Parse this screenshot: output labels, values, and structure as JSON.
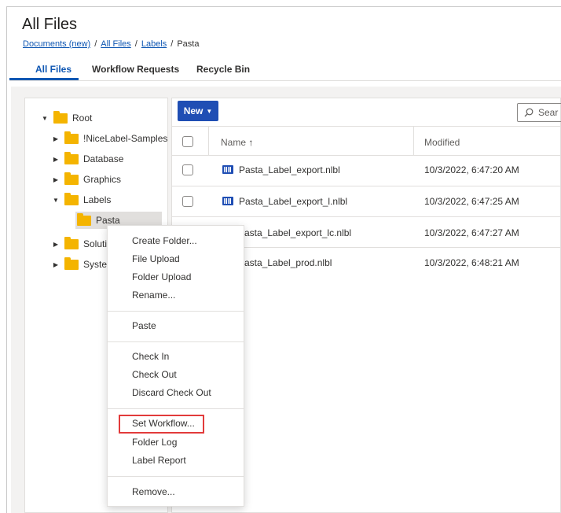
{
  "page": {
    "title": "All Files"
  },
  "breadcrumb": {
    "items": [
      "Documents (new)",
      "All Files",
      "Labels"
    ],
    "current": "Pasta",
    "separator": "/"
  },
  "tabs": [
    {
      "label": "All Files",
      "active": true
    },
    {
      "label": "Workflow Requests",
      "active": false
    },
    {
      "label": "Recycle Bin",
      "active": false
    }
  ],
  "tree": {
    "items": [
      {
        "label": "Root",
        "expanded": true
      },
      {
        "label": "!NiceLabel-Samples",
        "expanded": false
      },
      {
        "label": "Database",
        "expanded": false
      },
      {
        "label": "Graphics",
        "expanded": false
      },
      {
        "label": "Labels",
        "expanded": true
      },
      {
        "label": "Pasta",
        "selected": true
      },
      {
        "label": "Solutio",
        "expanded": false
      },
      {
        "label": "Syster",
        "expanded": false
      }
    ]
  },
  "toolbar": {
    "new_label": "New",
    "search_placeholder": "Sear"
  },
  "table": {
    "headers": {
      "name": "Name",
      "name_sort": "↑",
      "modified": "Modified"
    },
    "rows": [
      {
        "name": "Pasta_Label_export.nlbl",
        "modified": "10/3/2022, 6:47:20 AM"
      },
      {
        "name": "Pasta_Label_export_l.nlbl",
        "modified": "10/3/2022, 6:47:25 AM"
      },
      {
        "name": "asta_Label_export_lc.nlbl",
        "modified": "10/3/2022, 6:47:27 AM"
      },
      {
        "name": "asta_Label_prod.nlbl",
        "modified": "10/3/2022, 6:48:21 AM"
      }
    ]
  },
  "context_menu": {
    "items": [
      "Create Folder...",
      "File Upload",
      "Folder Upload",
      "Rename...",
      "Paste",
      "Check In",
      "Check Out",
      "Discard Check Out",
      "Set Workflow...",
      "Folder Log",
      "Label Report",
      "Remove..."
    ],
    "highlighted": "Set Workflow..."
  },
  "colors": {
    "accent": "#0f57b3",
    "button": "#1f4eb4",
    "folder": "#f4b400",
    "highlight_box": "#e23b3b"
  }
}
